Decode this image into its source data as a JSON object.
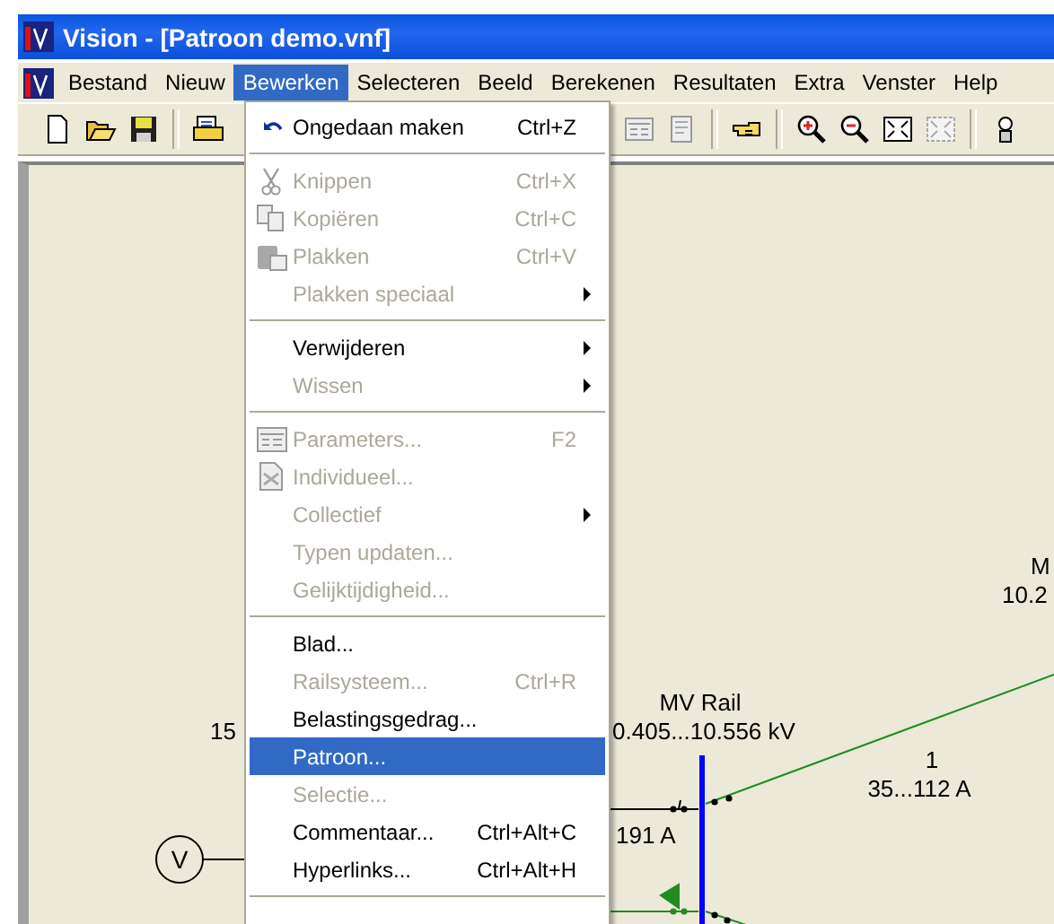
{
  "window": {
    "title": "Vision - [Patroon demo.vnf]"
  },
  "menu_bar": [
    {
      "label": "Bestand",
      "selected": false
    },
    {
      "label": "Nieuw",
      "selected": false
    },
    {
      "label": "Bewerken",
      "selected": true
    },
    {
      "label": "Selecteren",
      "selected": false
    },
    {
      "label": "Beeld",
      "selected": false
    },
    {
      "label": "Berekenen",
      "selected": false
    },
    {
      "label": "Resultaten",
      "selected": false
    },
    {
      "label": "Extra",
      "selected": false
    },
    {
      "label": "Venster",
      "selected": false
    },
    {
      "label": "Help",
      "selected": false
    }
  ],
  "edit_menu": [
    {
      "kind": "item",
      "label": "Ongedaan maken",
      "shortcut": "Ctrl+Z",
      "disabled": false,
      "selected": false,
      "submenu": false
    },
    {
      "kind": "separator"
    },
    {
      "kind": "item",
      "label": "Knippen",
      "shortcut": "Ctrl+X",
      "disabled": true,
      "selected": false,
      "submenu": false
    },
    {
      "kind": "item",
      "label": "Kopiëren",
      "shortcut": "Ctrl+C",
      "disabled": true,
      "selected": false,
      "submenu": false
    },
    {
      "kind": "item",
      "label": "Plakken",
      "shortcut": "Ctrl+V",
      "disabled": true,
      "selected": false,
      "submenu": false
    },
    {
      "kind": "item",
      "label": "Plakken speciaal",
      "disabled": true,
      "selected": false,
      "submenu": true
    },
    {
      "kind": "separator"
    },
    {
      "kind": "item",
      "label": "Verwijderen",
      "disabled": false,
      "selected": false,
      "submenu": true
    },
    {
      "kind": "item",
      "label": "Wissen",
      "disabled": true,
      "selected": false,
      "submenu": true
    },
    {
      "kind": "separator"
    },
    {
      "kind": "item",
      "label": "Parameters...",
      "shortcut": "F2",
      "disabled": true,
      "selected": false,
      "submenu": false
    },
    {
      "kind": "item",
      "label": "Individueel...",
      "disabled": true,
      "selected": false,
      "submenu": false
    },
    {
      "kind": "item",
      "label": "Collectief",
      "disabled": true,
      "selected": false,
      "submenu": true
    },
    {
      "kind": "item",
      "label": "Typen updaten...",
      "disabled": true,
      "selected": false,
      "submenu": false
    },
    {
      "kind": "item",
      "label": "Gelijktijdigheid...",
      "disabled": true,
      "selected": false,
      "submenu": false
    },
    {
      "kind": "separator"
    },
    {
      "kind": "item",
      "label": "Blad...",
      "disabled": false,
      "selected": false,
      "submenu": false
    },
    {
      "kind": "item",
      "label": "Railsysteem...",
      "shortcut": "Ctrl+R",
      "disabled": true,
      "selected": false,
      "submenu": false
    },
    {
      "kind": "item",
      "label": "Belastingsgedrag...",
      "disabled": false,
      "selected": false,
      "submenu": false
    },
    {
      "kind": "item",
      "label": "Patroon...",
      "disabled": false,
      "selected": true,
      "submenu": false
    },
    {
      "kind": "item",
      "label": "Selectie...",
      "disabled": true,
      "selected": false,
      "submenu": false
    },
    {
      "kind": "item",
      "label": "Commentaar...",
      "shortcut": "Ctrl+Alt+C",
      "disabled": false,
      "selected": false,
      "submenu": false
    },
    {
      "kind": "item",
      "label": "Hyperlinks...",
      "shortcut": "Ctrl+Alt+H",
      "disabled": false,
      "selected": false,
      "submenu": false
    },
    {
      "kind": "separator"
    }
  ],
  "diagram": {
    "left_label": "15",
    "source_symbol": "V",
    "rail": {
      "name": "MV Rail",
      "voltage": "0.405...10.556 kV"
    },
    "feeder_current": "191 A",
    "cable": {
      "name": "1",
      "current": "35...112 A"
    },
    "right_node": {
      "name": "M",
      "voltage": "10.2"
    }
  }
}
